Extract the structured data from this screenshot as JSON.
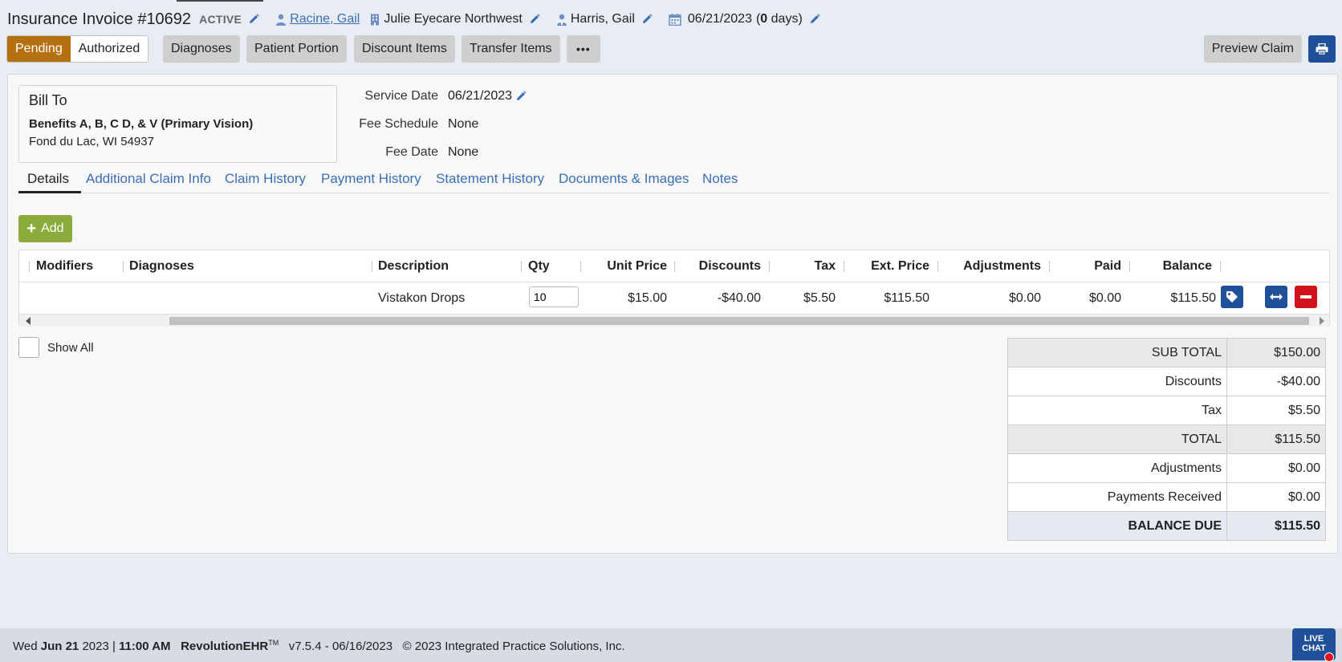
{
  "header": {
    "title": "Insurance Invoice #10692",
    "status": "ACTIVE",
    "patient": "Racine, Gail",
    "location": "Julie Eyecare Northwest",
    "provider": "Harris, Gail",
    "date": "06/21/2023",
    "days_open": "(",
    "days_count": "0",
    "days_close": " days)"
  },
  "toolbar": {
    "status_pending": "Pending",
    "status_authorized": "Authorized",
    "diagnoses": "Diagnoses",
    "patient_portion": "Patient Portion",
    "discount_items": "Discount Items",
    "transfer_items": "Transfer Items",
    "more": "•••",
    "preview_claim": "Preview Claim"
  },
  "bill_to": {
    "title": "Bill To",
    "name": "Benefits A, B, C D, & V (Primary Vision)",
    "address": "Fond du Lac, WI 54937"
  },
  "service": {
    "service_date_label": "Service Date",
    "service_date": "06/21/2023",
    "fee_schedule_label": "Fee Schedule",
    "fee_schedule": "None",
    "fee_date_label": "Fee Date",
    "fee_date": "None"
  },
  "tabs": [
    "Details",
    "Additional Claim Info",
    "Claim History",
    "Payment History",
    "Statement History",
    "Documents & Images",
    "Notes"
  ],
  "add_label": "Add",
  "table": {
    "columns": [
      "Modifiers",
      "Diagnoses",
      "Description",
      "Qty",
      "Unit Price",
      "Discounts",
      "Tax",
      "Ext. Price",
      "Adjustments",
      "Paid",
      "Balance"
    ],
    "rows": [
      {
        "description": "Vistakon Drops",
        "qty": "10",
        "unit_price": "$15.00",
        "discounts": "-$40.00",
        "tax": "$5.50",
        "ext_price": "$115.50",
        "adjustments": "$0.00",
        "paid": "$0.00",
        "balance": "$115.50"
      }
    ]
  },
  "show_all": "Show All",
  "totals": {
    "sub_total_label": "SUB TOTAL",
    "sub_total": "$150.00",
    "discounts_label": "Discounts",
    "discounts": "-$40.00",
    "tax_label": "Tax",
    "tax": "$5.50",
    "total_label": "TOTAL",
    "total": "$115.50",
    "adjustments_label": "Adjustments",
    "adjustments": "$0.00",
    "payments_label": "Payments Received",
    "payments": "$0.00",
    "balance_due_label": "BALANCE DUE",
    "balance_due": "$115.50"
  },
  "footer": {
    "weekday": "Wed",
    "month_day": "Jun 21",
    "year": "2023",
    "sep": "|",
    "time": "11:00 AM",
    "product": "RevolutionEHR",
    "tm": "TM",
    "version": "v7.5.4 - 06/16/2023",
    "copyright": "© 2023 Integrated Practice Solutions, Inc.",
    "live_chat_1": "LIVE",
    "live_chat_2": "CHAT"
  },
  "colors": {
    "pending": "#b5700f",
    "link": "#3a6fb7",
    "primary_button": "#21509a",
    "add_button": "#8bab3a",
    "remove_button": "#d2131c"
  }
}
